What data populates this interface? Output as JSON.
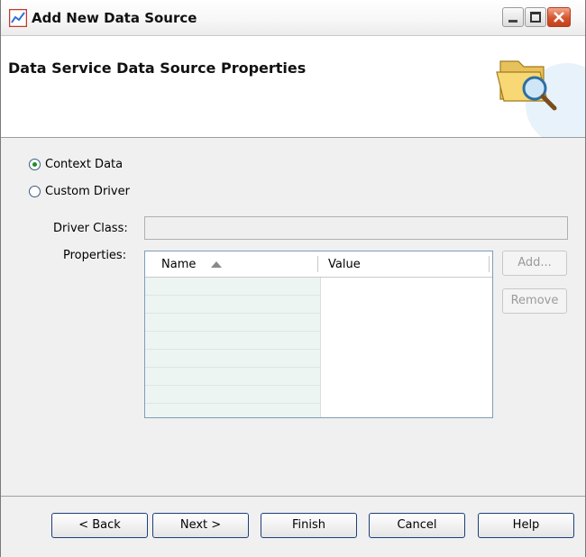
{
  "window": {
    "title": "Add New Data Source",
    "accent": "#d5542b"
  },
  "header": {
    "title": "Data Service Data Source Properties"
  },
  "options": [
    {
      "label": "Context Data",
      "selected": true
    },
    {
      "label": "Custom Driver",
      "selected": false
    }
  ],
  "driver": {
    "label": "Driver Class:",
    "value": ""
  },
  "properties": {
    "label": "Properties:",
    "columns": [
      "Name",
      "Value"
    ],
    "sort_column": "Name",
    "sort_direction": "ascending",
    "rows": []
  },
  "side_buttons": {
    "add": "Add...",
    "remove": "Remove"
  },
  "footer": {
    "back": "< Back",
    "next": "Next >",
    "finish": "Finish",
    "cancel": "Cancel",
    "help": "Help"
  }
}
